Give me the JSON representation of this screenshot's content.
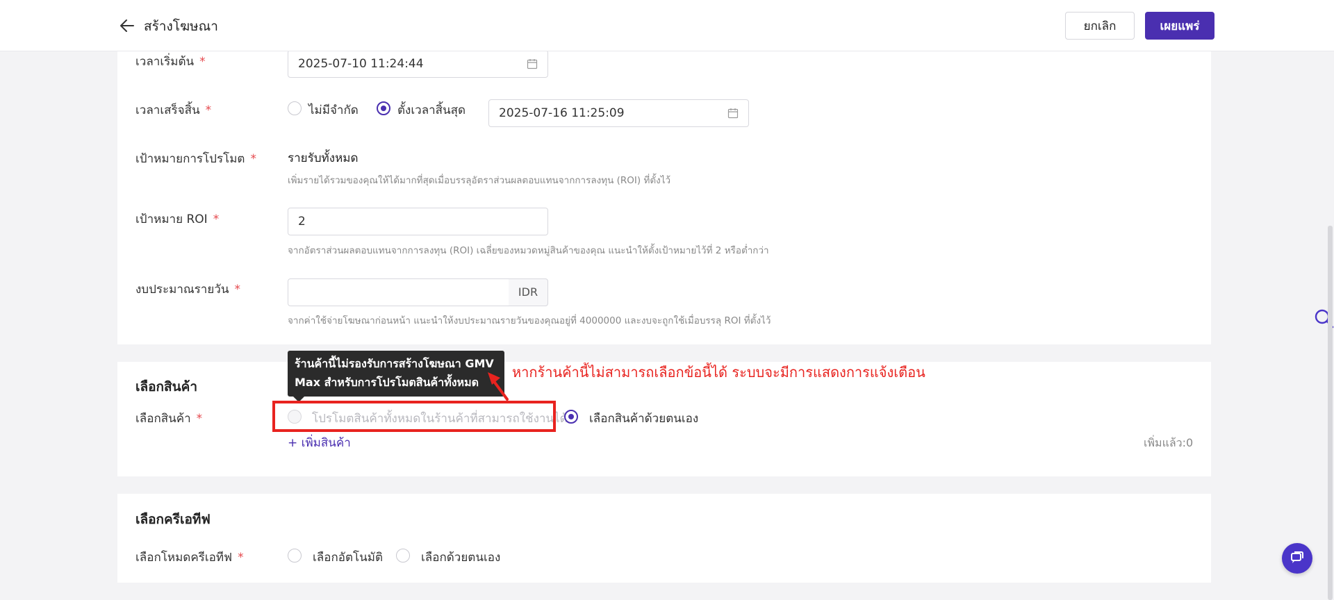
{
  "header": {
    "title": "สร้างโฆษณา",
    "cancel_label": "ยกเลิก",
    "publish_label": "เผยแพร่"
  },
  "form": {
    "start_time": {
      "label": "เวลาเริ่มต้น",
      "value": "2025-07-10 11:24:44"
    },
    "end_time": {
      "label": "เวลาเสร็จสิ้น",
      "option_unlimited": "ไม่มีจำกัด",
      "option_set_end": "ตั้งเวลาสิ้นสุด",
      "selected": "ตั้งเวลาสิ้นสุด",
      "value": "2025-07-16 11:25:09"
    },
    "promo_goal": {
      "label": "เป้าหมายการโปรโมต",
      "value": "รายรับทั้งหมด",
      "helper": "เพิ่มรายได้รวมของคุณให้ได้มากที่สุดเมื่อบรรลุอัตราส่วนผลตอบแทนจากการลงทุน (ROI) ที่ตั้งไว้"
    },
    "roi_goal": {
      "label": "เป้าหมาย ROI",
      "value": "2",
      "helper": "จากอัตราส่วนผลตอบแทนจากการลงทุน (ROI) เฉลี่ยของหมวดหมู่สินค้าของคุณ แนะนำให้ตั้งเป้าหมายไว้ที่ 2 หรือต่ำกว่า"
    },
    "daily_budget": {
      "label": "งบประมาณรายวัน",
      "value": "",
      "currency": "IDR",
      "helper": "จากค่าใช้จ่ายโฆษณาก่อนหน้า แนะนำให้งบประมาณรายวันของคุณอยู่ที่ 4000000 และงบจะถูกใช้เมื่อบรรลุ ROI ที่ตั้งไว้"
    }
  },
  "product_section": {
    "title": "เลือกสินค้า",
    "label": "เลือกสินค้า",
    "option_all": "โปรโมตสินค้าทั้งหมดในร้านค้าที่สามารถใช้งานได้",
    "option_manual": "เลือกสินค้าด้วยตนเอง",
    "selected": "เลือกสินค้าด้วยตนเอง",
    "add_link": "+ เพิ่มสินค้า",
    "added_count": "เพิ่มแล้ว:0",
    "tooltip_line1": "ร้านค้านี้ไม่รองรับการสร้างโฆษณา GMV",
    "tooltip_line2": "Max สำหรับการโปรโมตสินค้าทั้งหมด",
    "annotation": "หากร้านค้านี้ไม่สามารถเลือกข้อนี้ได้ ระบบจะมีการแสดงการแจ้งเตือน"
  },
  "creative_section": {
    "title": "เลือกครีเอทีฟ",
    "label": "เลือกโหมดครีเอทีฟ",
    "option_auto": "เลือกอัตโนมัติ",
    "option_manual": "เลือกด้วยตนเอง"
  },
  "colors": {
    "accent": "#4a2fb0",
    "required": "#e5484d",
    "annotation": "#e8231f"
  },
  "icons": [
    "back-arrow-icon",
    "calendar-icon",
    "search-icon",
    "chat-icon"
  ]
}
